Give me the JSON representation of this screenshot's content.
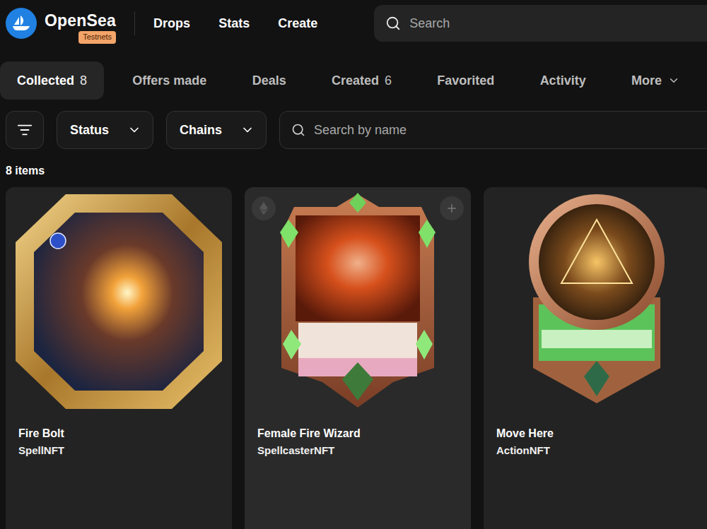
{
  "header": {
    "brand": "OpenSea",
    "badge": "Testnets",
    "nav": [
      "Drops",
      "Stats",
      "Create"
    ],
    "search": {
      "placeholder": "Search"
    }
  },
  "tabs": [
    {
      "label": "Collected",
      "count": "8",
      "selected": true
    },
    {
      "label": "Offers made",
      "selected": false
    },
    {
      "label": "Deals",
      "selected": false
    },
    {
      "label": "Created",
      "count": "6",
      "selected": false
    },
    {
      "label": "Favorited",
      "selected": false
    },
    {
      "label": "Activity",
      "selected": false
    },
    {
      "label": "More",
      "selected": false
    }
  ],
  "filters": {
    "dropdowns": [
      "Status",
      "Chains"
    ],
    "search": {
      "placeholder": "Search by name"
    }
  },
  "item_count": "8 items",
  "items": [
    {
      "name": "Fire Bolt",
      "collection": "SpellNFT",
      "kind": "octagon",
      "hovered": false
    },
    {
      "name": "Female Fire Wizard",
      "collection": "SpellcasterNFT",
      "kind": "card",
      "hovered": true
    },
    {
      "name": "Move Here",
      "collection": "ActionNFT",
      "kind": "medallion",
      "hovered": false
    }
  ]
}
